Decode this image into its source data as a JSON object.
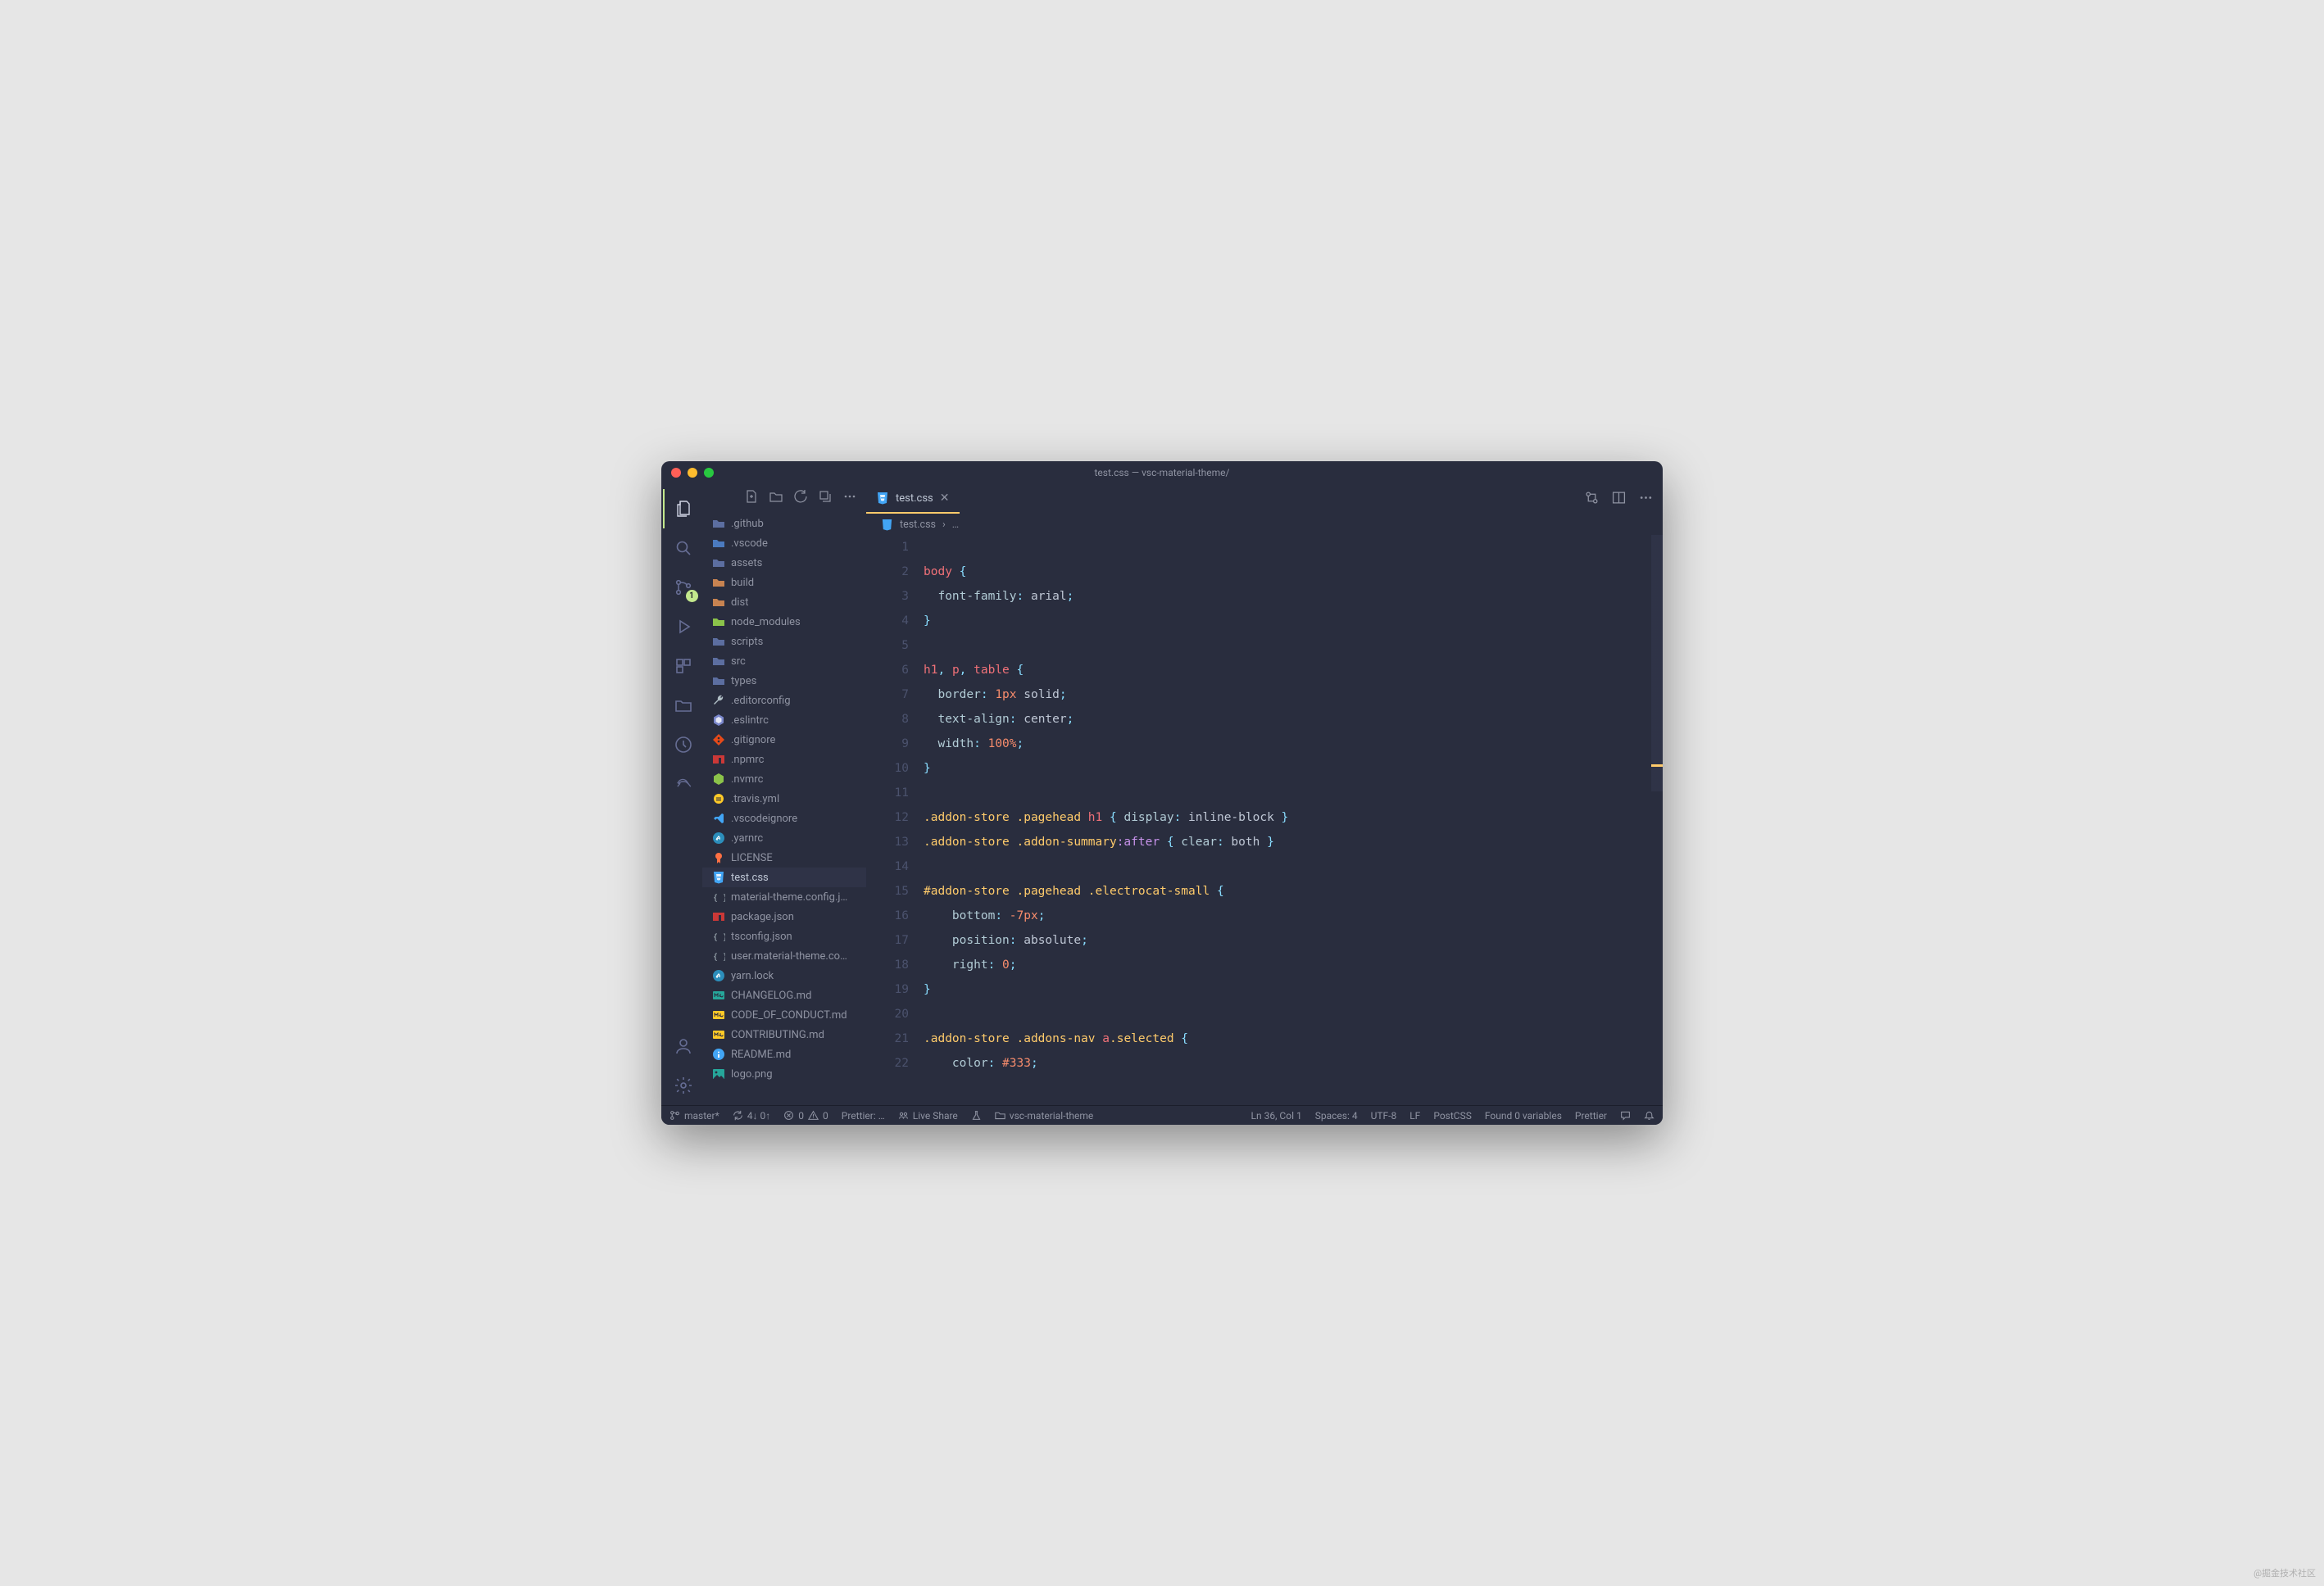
{
  "window": {
    "title": "test.css — vsc-material-theme/"
  },
  "activitybar": {
    "scm_badge": "1"
  },
  "explorer": {
    "tree": [
      {
        "label": ".github",
        "icon": "folder",
        "color": "#5c6ea0"
      },
      {
        "label": ".vscode",
        "icon": "folder",
        "color": "#4b7abf"
      },
      {
        "label": "assets",
        "icon": "folder",
        "color": "#5c6ea0"
      },
      {
        "label": "build",
        "icon": "folder",
        "color": "#c78351"
      },
      {
        "label": "dist",
        "icon": "folder",
        "color": "#c78351"
      },
      {
        "label": "node_modules",
        "icon": "folder",
        "color": "#8bc34a"
      },
      {
        "label": "scripts",
        "icon": "folder",
        "color": "#5c6ea0"
      },
      {
        "label": "src",
        "icon": "folder",
        "color": "#5c6ea0"
      },
      {
        "label": "types",
        "icon": "folder",
        "color": "#5c6ea0"
      },
      {
        "label": ".editorconfig",
        "icon": "wrench",
        "color": "#b0bec5"
      },
      {
        "label": ".eslintrc",
        "icon": "eslint",
        "color": "#7986cb"
      },
      {
        "label": ".gitignore",
        "icon": "git",
        "color": "#e64a19"
      },
      {
        "label": ".npmrc",
        "icon": "npm",
        "color": "#cb3837"
      },
      {
        "label": ".nvmrc",
        "icon": "node",
        "color": "#8bc34a"
      },
      {
        "label": ".travis.yml",
        "icon": "travis",
        "color": "#ffca28"
      },
      {
        "label": ".vscodeignore",
        "icon": "vscode",
        "color": "#42a5f5"
      },
      {
        "label": ".yarnrc",
        "icon": "yarn",
        "color": "#2c8ebb"
      },
      {
        "label": "LICENSE",
        "icon": "cert",
        "color": "#ff7043"
      },
      {
        "label": "test.css",
        "icon": "css",
        "color": "#42a5f5",
        "selected": true
      },
      {
        "label": "material-theme.config.j…",
        "icon": "json",
        "color": "#b0bec5"
      },
      {
        "label": "package.json",
        "icon": "npm",
        "color": "#cb3837"
      },
      {
        "label": "tsconfig.json",
        "icon": "json",
        "color": "#b0bec5"
      },
      {
        "label": "user.material-theme.co…",
        "icon": "json",
        "color": "#b0bec5"
      },
      {
        "label": "yarn.lock",
        "icon": "yarn",
        "color": "#2c8ebb"
      },
      {
        "label": "CHANGELOG.md",
        "icon": "md",
        "color": "#26a69a"
      },
      {
        "label": "CODE_OF_CONDUCT.md",
        "icon": "md",
        "color": "#ffca28"
      },
      {
        "label": "CONTRIBUTING.md",
        "icon": "md",
        "color": "#ffca28"
      },
      {
        "label": "README.md",
        "icon": "info",
        "color": "#42a5f5"
      },
      {
        "label": "logo.png",
        "icon": "image",
        "color": "#26a69a"
      }
    ]
  },
  "editor": {
    "tab": {
      "label": "test.css"
    },
    "breadcrumb": {
      "file": "test.css",
      "tail": "…"
    },
    "line_start": 1,
    "lines": [
      {
        "n": 1,
        "t": []
      },
      {
        "n": 2,
        "t": [
          [
            "tag",
            "body"
          ],
          [
            "val",
            " "
          ],
          [
            "punc",
            "{"
          ]
        ]
      },
      {
        "n": 3,
        "t": [
          [
            "val",
            "  "
          ],
          [
            "prop",
            "font-family"
          ],
          [
            "punc",
            ":"
          ],
          [
            "val",
            " arial"
          ],
          [
            "punc",
            ";"
          ]
        ]
      },
      {
        "n": 4,
        "t": [
          [
            "punc",
            "}"
          ]
        ]
      },
      {
        "n": 5,
        "t": []
      },
      {
        "n": 6,
        "t": [
          [
            "tag",
            "h1"
          ],
          [
            "punc",
            ","
          ],
          [
            "val",
            " "
          ],
          [
            "tag",
            "p"
          ],
          [
            "punc",
            ","
          ],
          [
            "val",
            " "
          ],
          [
            "tag",
            "table"
          ],
          [
            "val",
            " "
          ],
          [
            "punc",
            "{"
          ]
        ]
      },
      {
        "n": 7,
        "t": [
          [
            "val",
            "  "
          ],
          [
            "prop",
            "border"
          ],
          [
            "punc",
            ":"
          ],
          [
            "val",
            " "
          ],
          [
            "num",
            "1px"
          ],
          [
            "val",
            " solid"
          ],
          [
            "punc",
            ";"
          ]
        ]
      },
      {
        "n": 8,
        "t": [
          [
            "val",
            "  "
          ],
          [
            "prop",
            "text-align"
          ],
          [
            "punc",
            ":"
          ],
          [
            "val",
            " center"
          ],
          [
            "punc",
            ";"
          ]
        ]
      },
      {
        "n": 9,
        "t": [
          [
            "val",
            "  "
          ],
          [
            "prop",
            "width"
          ],
          [
            "punc",
            ":"
          ],
          [
            "val",
            " "
          ],
          [
            "num",
            "100%"
          ],
          [
            "punc",
            ";"
          ]
        ]
      },
      {
        "n": 10,
        "t": [
          [
            "punc",
            "}"
          ]
        ]
      },
      {
        "n": 11,
        "t": []
      },
      {
        "n": 12,
        "t": [
          [
            "sel",
            ".addon-store .pagehead "
          ],
          [
            "tag",
            "h1"
          ],
          [
            "val",
            " "
          ],
          [
            "punc",
            "{"
          ],
          [
            "val",
            " "
          ],
          [
            "prop",
            "display"
          ],
          [
            "punc",
            ":"
          ],
          [
            "val",
            " inline-block "
          ],
          [
            "punc",
            "}"
          ]
        ]
      },
      {
        "n": 13,
        "t": [
          [
            "sel",
            ".addon-store .addon-summary"
          ],
          [
            "pseudo",
            ":after"
          ],
          [
            "val",
            " "
          ],
          [
            "punc",
            "{"
          ],
          [
            "val",
            " "
          ],
          [
            "prop",
            "clear"
          ],
          [
            "punc",
            ":"
          ],
          [
            "val",
            " both "
          ],
          [
            "punc",
            "}"
          ]
        ]
      },
      {
        "n": 14,
        "t": []
      },
      {
        "n": 15,
        "t": [
          [
            "sel",
            "#addon-store .pagehead .electrocat-small"
          ],
          [
            "val",
            " "
          ],
          [
            "punc",
            "{"
          ]
        ]
      },
      {
        "n": 16,
        "t": [
          [
            "val",
            "    "
          ],
          [
            "prop",
            "bottom"
          ],
          [
            "punc",
            ":"
          ],
          [
            "val",
            " "
          ],
          [
            "num",
            "-7px"
          ],
          [
            "punc",
            ";"
          ]
        ]
      },
      {
        "n": 17,
        "t": [
          [
            "val",
            "    "
          ],
          [
            "prop",
            "position"
          ],
          [
            "punc",
            ":"
          ],
          [
            "val",
            " absolute"
          ],
          [
            "punc",
            ";"
          ]
        ]
      },
      {
        "n": 18,
        "t": [
          [
            "val",
            "    "
          ],
          [
            "prop",
            "right"
          ],
          [
            "punc",
            ":"
          ],
          [
            "val",
            " "
          ],
          [
            "num",
            "0"
          ],
          [
            "punc",
            ";"
          ]
        ]
      },
      {
        "n": 19,
        "t": [
          [
            "punc",
            "}"
          ]
        ]
      },
      {
        "n": 20,
        "t": []
      },
      {
        "n": 21,
        "t": [
          [
            "sel",
            ".addon-store .addons-nav "
          ],
          [
            "tag",
            "a"
          ],
          [
            "sel",
            ".selected"
          ],
          [
            "val",
            " "
          ],
          [
            "punc",
            "{"
          ]
        ]
      },
      {
        "n": 22,
        "t": [
          [
            "val",
            "    "
          ],
          [
            "prop",
            "color"
          ],
          [
            "punc",
            ":"
          ],
          [
            "val",
            " "
          ],
          [
            "num",
            "#333"
          ],
          [
            "punc",
            ";"
          ]
        ]
      }
    ]
  },
  "status": {
    "branch": "master*",
    "sync": "4↓ 0↑",
    "errors": "0",
    "warnings": "0",
    "prettier_left": "Prettier: …",
    "liveshare": "Live Share",
    "folder": "vsc-material-theme",
    "cursor": "Ln 36, Col 1",
    "spaces": "Spaces: 4",
    "encoding": "UTF-8",
    "eol": "LF",
    "language": "PostCSS",
    "variables": "Found 0 variables",
    "prettier_right": "Prettier"
  },
  "watermark": "@掘金技术社区"
}
